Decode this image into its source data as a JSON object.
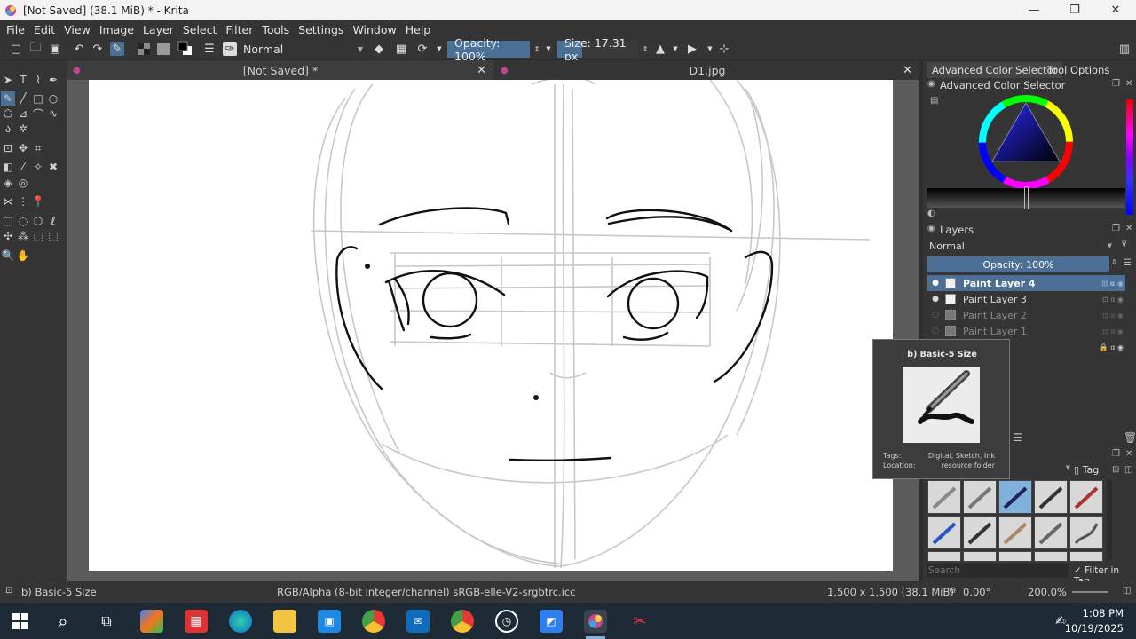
{
  "window": {
    "title": "[Not Saved]  (38.1 MiB)  * - Krita",
    "minimize_glyph": "—",
    "maximize_glyph": "❐",
    "close_glyph": "✕"
  },
  "menu": [
    "File",
    "Edit",
    "View",
    "Image",
    "Layer",
    "Select",
    "Filter",
    "Tools",
    "Settings",
    "Window",
    "Help"
  ],
  "toolbar": {
    "blend_mode": "Normal",
    "opacity_label": "Opacity: 100%",
    "opacity_value": 1.0,
    "size_label": "Size: 17.31 px",
    "size_fill": 0.3
  },
  "documents": {
    "tabs": [
      {
        "label": "[Not Saved]  *",
        "active": true
      },
      {
        "label": "D1.jpg",
        "active": false
      }
    ],
    "close_glyph": "✕"
  },
  "dock": {
    "tabs": [
      "Advanced Color Selector",
      "Tool Options"
    ],
    "color_panel_title": "Advanced Color Selector",
    "layers_title": "Layers",
    "layers_blend": "Normal",
    "layers_opacity": "Opacity:  100%",
    "layers": [
      {
        "name": "Paint Layer 4",
        "selected": true,
        "visible": true
      },
      {
        "name": "Paint Layer 3",
        "selected": false,
        "visible": true
      },
      {
        "name": "Paint Layer 2",
        "selected": false,
        "visible": false
      },
      {
        "name": "Paint Layer 1",
        "selected": false,
        "visible": false
      }
    ],
    "partial_layer_suffix": "d",
    "brush_tag_label": "Tag",
    "brush_search_placeholder": "Search",
    "filter_in_tag": "Filter in Tag"
  },
  "tooltip": {
    "title": "b) Basic-5 Size",
    "tags_label": "Tags:",
    "tags_value": "Digital, Sketch, Ink",
    "location_label": "Location:",
    "location_value": "resource folder"
  },
  "status": {
    "brush": "b) Basic-5 Size",
    "color_model": "RGB/Alpha (8-bit integer/channel)  sRGB-elle-V2-srgbtrc.icc",
    "dimensions": "1,500 x 1,500 (38.1 MiB)",
    "rotation": "0.00°",
    "zoom": "200.0%"
  },
  "taskbar": {
    "time": "1:08 PM",
    "date": "10/19/2025"
  },
  "colors": {
    "accent": "#4b6f95",
    "panel": "#353535",
    "canvas_bg": "#5c5c5c",
    "taskbar": "#1f2a37"
  }
}
